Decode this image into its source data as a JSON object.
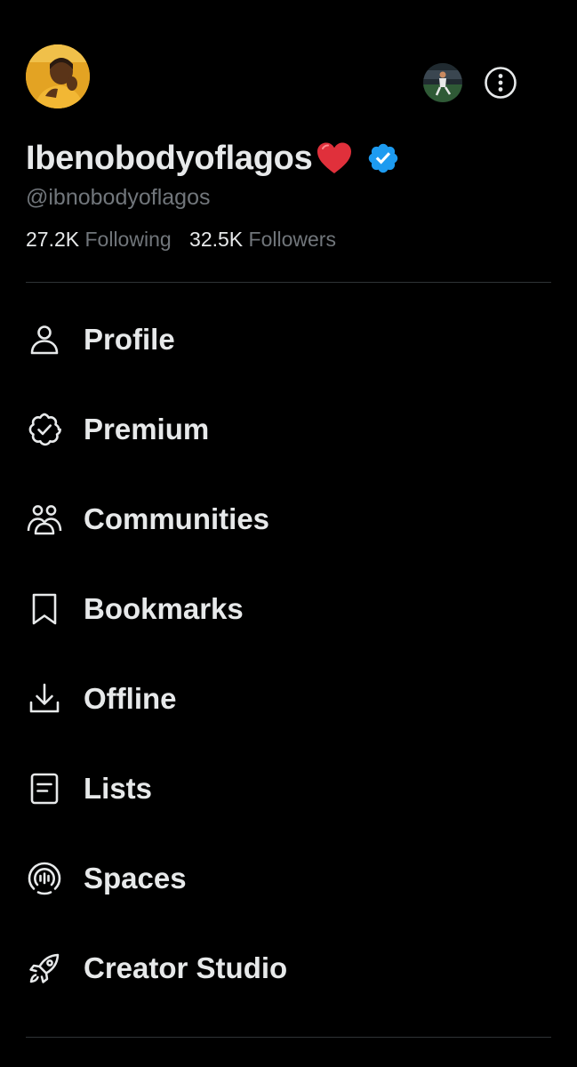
{
  "profile": {
    "display_name": "Ibenobodyoflagos",
    "handle": "@ibnobodyoflagos",
    "verified": true,
    "verified_color": "#1d9bf0",
    "heart_icon": "red-heart-icon"
  },
  "stats": {
    "following_count": "27.2K",
    "following_label": "Following",
    "followers_count": "32.5K",
    "followers_label": "Followers"
  },
  "header": {
    "more_icon": "more-options-icon",
    "alt_account_icon": "account-avatar"
  },
  "menu": {
    "items": [
      {
        "label": "Profile",
        "icon": "person-icon"
      },
      {
        "label": "Premium",
        "icon": "verified-badge-icon"
      },
      {
        "label": "Communities",
        "icon": "communities-icon"
      },
      {
        "label": "Bookmarks",
        "icon": "bookmark-icon"
      },
      {
        "label": "Offline",
        "icon": "download-icon"
      },
      {
        "label": "Lists",
        "icon": "list-icon"
      },
      {
        "label": "Spaces",
        "icon": "spaces-icon"
      },
      {
        "label": "Creator Studio",
        "icon": "rocket-icon"
      }
    ]
  },
  "colors": {
    "background": "#000000",
    "text_primary": "#e7e9ea",
    "text_secondary": "#71767b",
    "divider": "#2f3336",
    "accent": "#1d9bf0"
  }
}
